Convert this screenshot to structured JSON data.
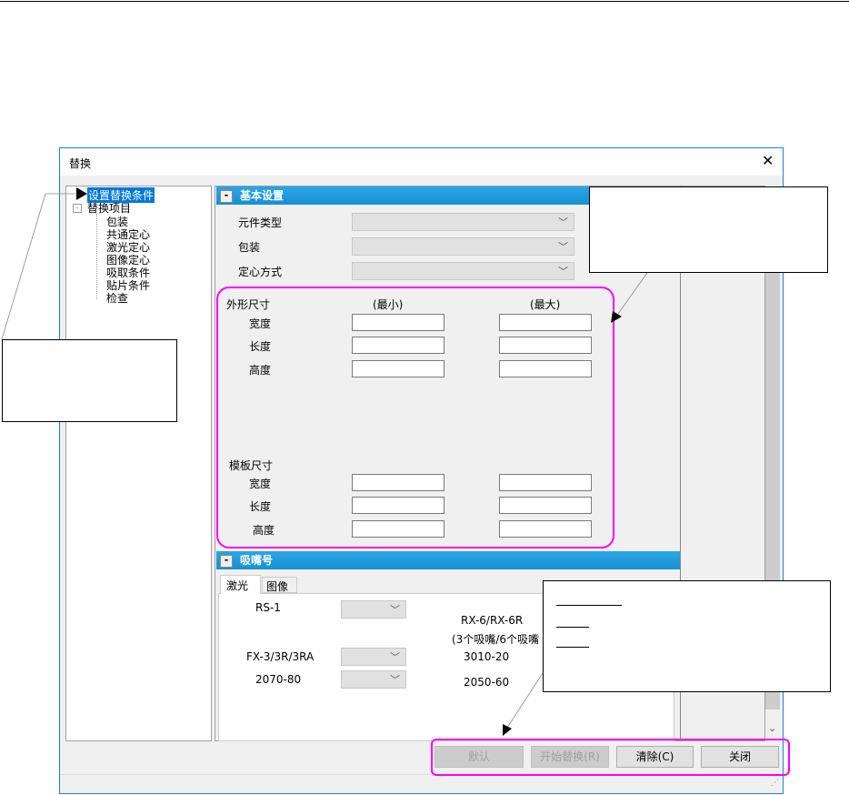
{
  "dialog": {
    "title": "替换",
    "close_icon": "close-icon"
  },
  "tree": {
    "root": "设置替换条件",
    "group": "替换项目",
    "items": [
      "包装",
      "共通定心",
      "激光定心",
      "图像定心",
      "吸取条件",
      "贴片条件",
      "检查"
    ]
  },
  "basic": {
    "header": "基本设置",
    "fields": [
      "元件类型",
      "包装",
      "定心方式"
    ],
    "size_label": "外形尺寸",
    "min_label": "(最小)",
    "max_label": "(最大)",
    "dims": [
      "宽度",
      "长度",
      "高度"
    ],
    "template_label": "模板尺寸",
    "template_dims": [
      "宽度",
      "长度",
      "高度"
    ]
  },
  "nozzle": {
    "header": "吸嘴号",
    "tabs": [
      "激光",
      "图像"
    ],
    "left_rows": [
      "RS-1",
      "FX-3/3R/3RA",
      "2070-80"
    ],
    "right_title": "RX-6/RX-6R",
    "right_sub": "(3个吸嘴/6个吸嘴",
    "right_rows": [
      "3010-20",
      "2050-60"
    ]
  },
  "buttons": {
    "default": "默认",
    "start": "开始替换(R)",
    "clear": "清除(C)",
    "close": "关闭"
  },
  "colors": {
    "highlight": "#f0f",
    "section": "#1a96d8",
    "selection": "#0078d7"
  }
}
